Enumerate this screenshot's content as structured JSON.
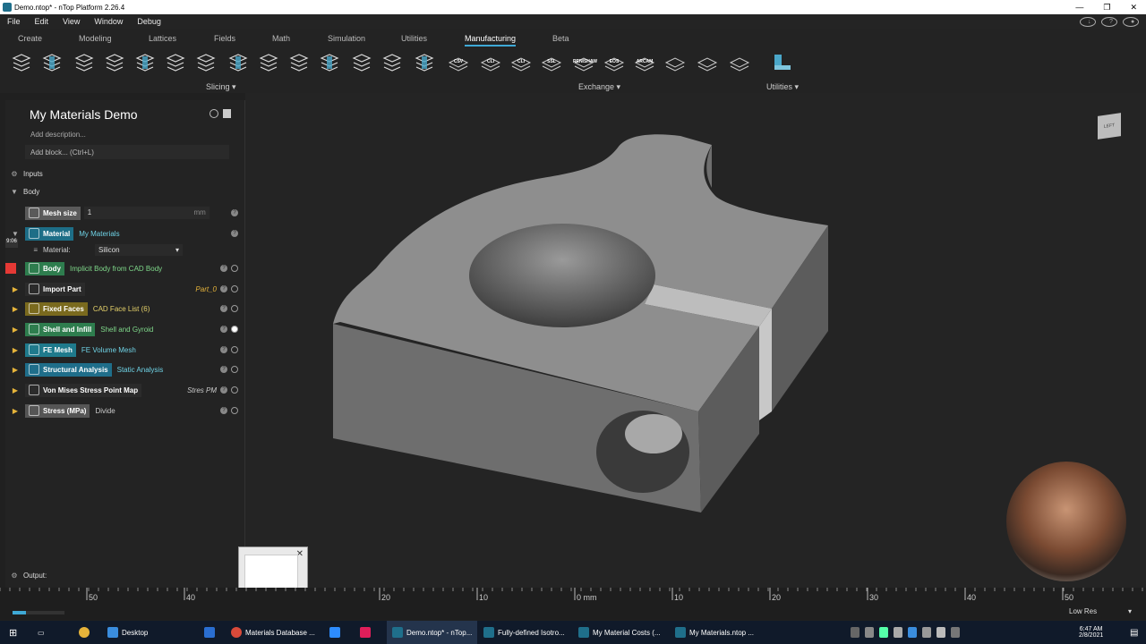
{
  "window": {
    "title": "Demo.ntop* - nTop Platform 2.26.4",
    "minimize": "—",
    "restore": "❐",
    "close": "✕"
  },
  "menu": [
    "File",
    "Edit",
    "View",
    "Window",
    "Debug"
  ],
  "tabs": [
    {
      "label": "Create",
      "active": false
    },
    {
      "label": "Modeling",
      "active": false
    },
    {
      "label": "Lattices",
      "active": false
    },
    {
      "label": "Fields",
      "active": false
    },
    {
      "label": "Math",
      "active": false
    },
    {
      "label": "Simulation",
      "active": false
    },
    {
      "label": "Utilities",
      "active": false
    },
    {
      "label": "Manufacturing",
      "active": true
    },
    {
      "label": "Beta",
      "active": false
    }
  ],
  "toolbar": {
    "slicing_label": "Slicing",
    "exchange_label": "Exchange",
    "utilities_label": "Utilities",
    "exchange_tools": [
      "CSV",
      "CLI",
      "CLI",
      "SSL",
      "RENISHAW",
      "EOS",
      "ARCAM",
      "",
      "",
      ""
    ]
  },
  "notebook": {
    "title": "My Materials Demo",
    "add_description": "Add description...",
    "add_block": "Add block... (Ctrl+L)",
    "inputs_label": "Inputs",
    "body_label": "Body",
    "timestamp": "9:06",
    "mesh_size": {
      "label": "Mesh size",
      "value": "1",
      "unit": "mm"
    },
    "material": {
      "label": "Material",
      "value": "My Materials",
      "field_label": "Material:",
      "selected": "Silicon"
    },
    "blocks": [
      {
        "name": "Body",
        "value": "Implicit Body from CAD Body",
        "color": "#2e7d4e",
        "valcolor": "#7fd88a",
        "alias": ""
      },
      {
        "name": "Import Part",
        "value": "",
        "color": "#2b2b2b",
        "valcolor": "#e5b33a",
        "alias": "Part_0"
      },
      {
        "name": "Fixed Faces",
        "value": "CAD Face List (6)",
        "color": "#7a6a1e",
        "valcolor": "#e5d16a",
        "alias": ""
      },
      {
        "name": "Shell and Infill",
        "value": "Shell and Gyroid",
        "color": "#2e7d4e",
        "valcolor": "#7fd88a",
        "alias": ""
      },
      {
        "name": "FE Mesh",
        "value": "FE Volume Mesh",
        "color": "#1f7a8c",
        "valcolor": "#6fd3e6",
        "alias": ""
      },
      {
        "name": "Structural Analysis",
        "value": "Static Analysis",
        "color": "#1f6e8a",
        "valcolor": "#6fd3e6",
        "alias": ""
      },
      {
        "name": "Von Mises Stress Point Map",
        "value": "",
        "color": "#2b2b2b",
        "valcolor": "#ccc",
        "alias": "Stres PM"
      },
      {
        "name": "Stress (MPa)",
        "value": "Divide",
        "color": "#555",
        "valcolor": "#ccc",
        "alias": ""
      }
    ],
    "output_label": "Output:"
  },
  "viewcube": {
    "face": "LEFT"
  },
  "ruler": {
    "ticks": [
      "50",
      "40",
      "20",
      "10",
      "0 mm",
      "10",
      "20",
      "30",
      "40",
      "50"
    ],
    "tick_values": [
      -50,
      -40,
      -20,
      -10,
      0,
      10,
      20,
      30,
      40,
      50
    ]
  },
  "status": {
    "resolution": "Low Res"
  },
  "taskbar": {
    "items": [
      "Desktop",
      "Materials Database ...",
      "Demo.ntop* - nTop...",
      "Fully-defined Isotro...",
      "My Material Costs (...",
      "My Materials.ntop ..."
    ],
    "time": "6:47 AM",
    "date": "2/8/2021"
  }
}
